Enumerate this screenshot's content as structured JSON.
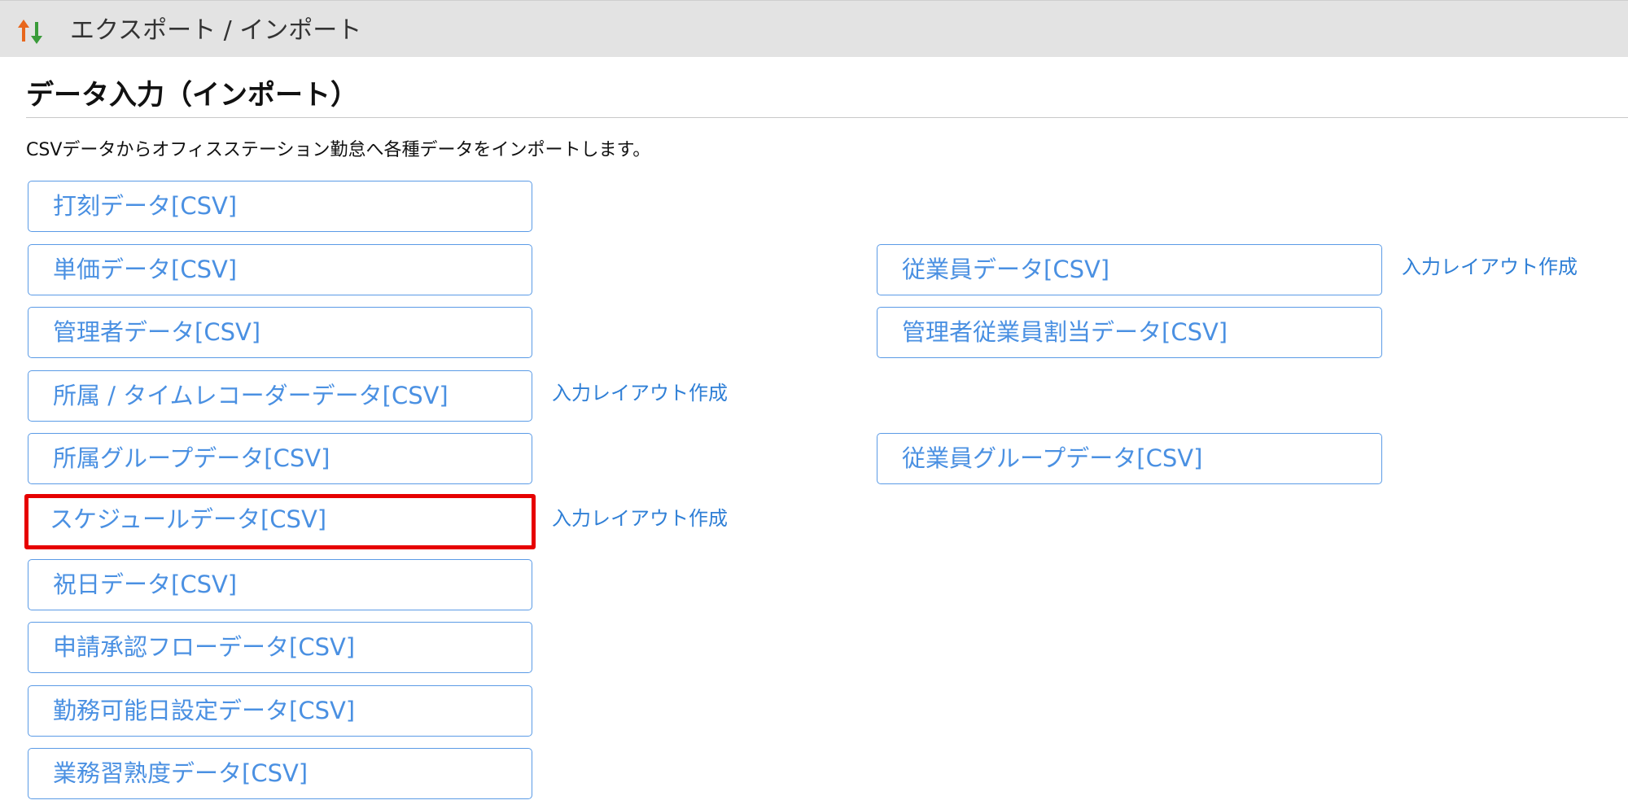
{
  "header": {
    "title": "エクスポート / インポート",
    "icon": "up-down-arrows-icon",
    "colors": {
      "up_arrow": "#e8671d",
      "down_arrow": "#3a9b3a",
      "background": "#e3e3e3"
    }
  },
  "page": {
    "title": "データ入力（インポート）",
    "description": "CSVデータからオフィスステーション勤怠へ各種データをインポートします。"
  },
  "colors": {
    "button_text": "#4a90e2",
    "button_border": "#5b9be6",
    "link": "#2f7fd6",
    "highlight": "#e60000"
  },
  "left_buttons": [
    {
      "label": "打刻データ[CSV]"
    },
    {
      "label": "単価データ[CSV]"
    },
    {
      "label": "管理者データ[CSV]"
    },
    {
      "label": "所属 / タイムレコーダーデータ[CSV]",
      "layout_link": "入力レイアウト作成"
    },
    {
      "label": "所属グループデータ[CSV]"
    },
    {
      "label": "スケジュールデータ[CSV]",
      "layout_link": "入力レイアウト作成",
      "highlighted": true
    },
    {
      "label": "祝日データ[CSV]"
    },
    {
      "label": "申請承認フローデータ[CSV]"
    },
    {
      "label": "勤務可能日設定データ[CSV]"
    },
    {
      "label": "業務習熟度データ[CSV]"
    }
  ],
  "right_buttons": [
    {
      "label": "従業員データ[CSV]",
      "layout_link": "入力レイアウト作成"
    },
    {
      "label": "管理者従業員割当データ[CSV]"
    },
    {
      "label": "従業員グループデータ[CSV]"
    }
  ]
}
